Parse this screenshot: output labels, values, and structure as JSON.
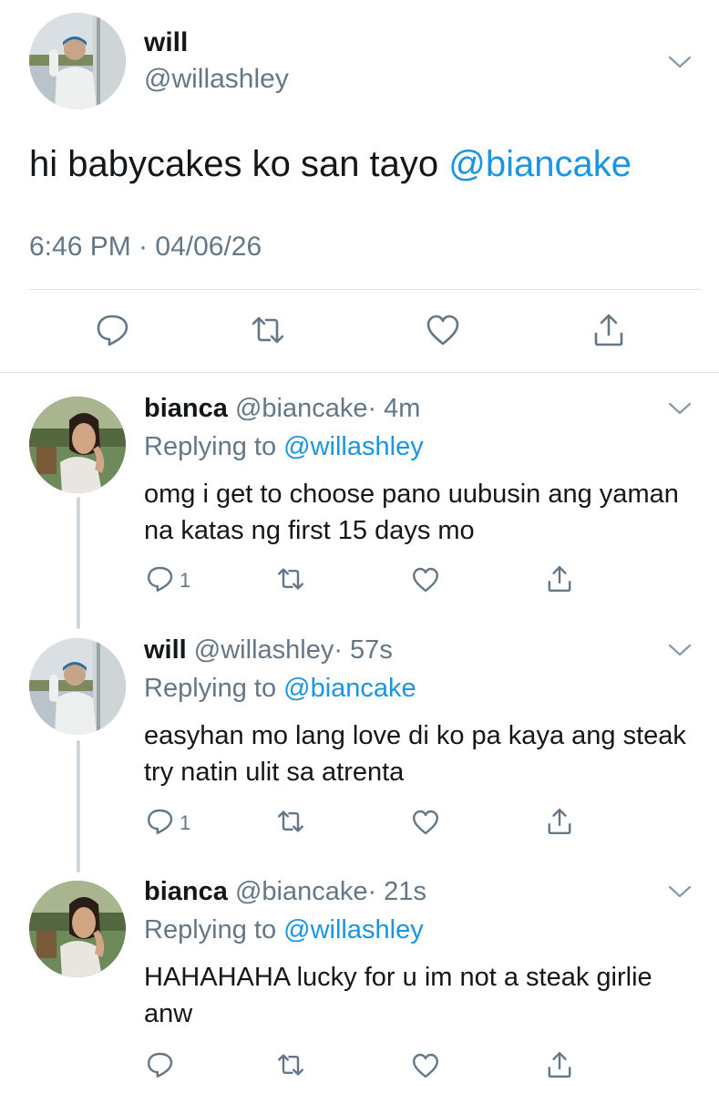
{
  "tweet": {
    "name": "will",
    "handle": "@willashley",
    "text": "hi babycakes ko san tayo ",
    "mention": "@biancake",
    "timestamp": "6:46 PM · 04/06/26"
  },
  "replies": [
    {
      "name": "bianca",
      "handle": "@biancake",
      "time": "· 4m",
      "replying_prefix": "Replying to ",
      "replying_to": "@willashley",
      "text": "omg i get to choose pano uubusin ang yaman na katas ng first 15 days mo",
      "reply_count": "1"
    },
    {
      "name": "will",
      "handle": "@willashley",
      "time": "· 57s",
      "replying_prefix": "Replying to ",
      "replying_to": "@biancake",
      "text": "easyhan mo lang love di ko pa kaya ang steak try natin ulit sa atrenta",
      "reply_count": "1"
    },
    {
      "name": "bianca",
      "handle": "@biancake",
      "time": "· 21s",
      "replying_prefix": "Replying to ",
      "replying_to": "@willashley",
      "text": "HAHAHAHA lucky for u im not a steak girlie anw",
      "reply_count": ""
    }
  ],
  "colors": {
    "link": "#1b95e0",
    "secondary_text": "#657786",
    "divider": "#dfe3e6",
    "icon": "#657786"
  },
  "icons": [
    "reply-icon",
    "retweet-icon",
    "like-icon",
    "share-icon",
    "chevron-down-icon"
  ]
}
